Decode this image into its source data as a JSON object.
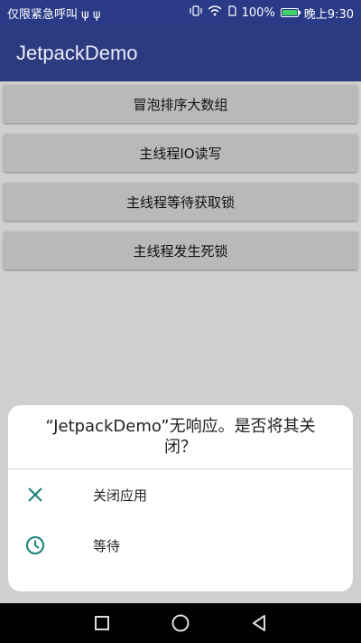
{
  "status_bar": {
    "carrier": "仅限紧急呼叫 ψ ψ",
    "battery_percent": "100%",
    "time": "晚上9:30"
  },
  "app": {
    "title": "JetpackDemo"
  },
  "buttons": [
    {
      "label": "冒泡排序大数组"
    },
    {
      "label": "主线程IO读写"
    },
    {
      "label": "主线程等待获取锁"
    },
    {
      "label": "主线程发生死锁"
    }
  ],
  "dialog": {
    "title": "“JetpackDemo”无响应。是否将其关闭？",
    "options": [
      {
        "label": "关闭应用",
        "icon": "close-icon"
      },
      {
        "label": "等待",
        "icon": "clock-icon"
      }
    ],
    "accent_color": "#188077"
  },
  "navbar": {
    "icons": [
      "recents-icon",
      "home-icon",
      "back-icon"
    ]
  }
}
